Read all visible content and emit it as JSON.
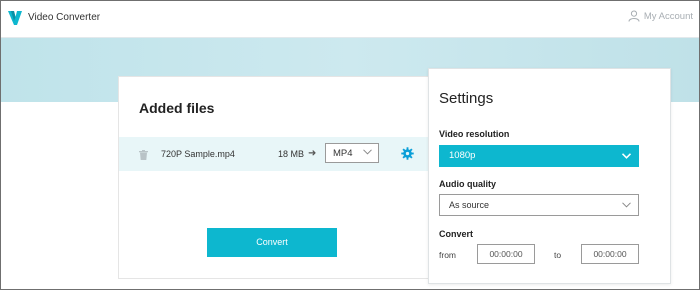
{
  "app": {
    "title": "Video Converter",
    "brand_color": "#0db7cf",
    "account_label": "My Account",
    "account_icon": "user-icon",
    "logo_icon": "v-logo-icon"
  },
  "files_panel": {
    "heading": "Added files",
    "files": [
      {
        "name": "720P Sample.mp4",
        "size": "18 MB",
        "format": "MP4",
        "delete_icon": "trash-icon",
        "settings_icon": "gear-icon"
      }
    ],
    "convert_label": "Convert"
  },
  "settings_panel": {
    "heading": "Settings",
    "video_resolution": {
      "label": "Video resolution",
      "value": "1080p"
    },
    "audio_quality": {
      "label": "Audio quality",
      "value": "As source"
    },
    "convert": {
      "label": "Convert",
      "from_label": "from",
      "from_value": "00:00:00",
      "to_label": "to",
      "to_value": "00:00:00"
    }
  }
}
